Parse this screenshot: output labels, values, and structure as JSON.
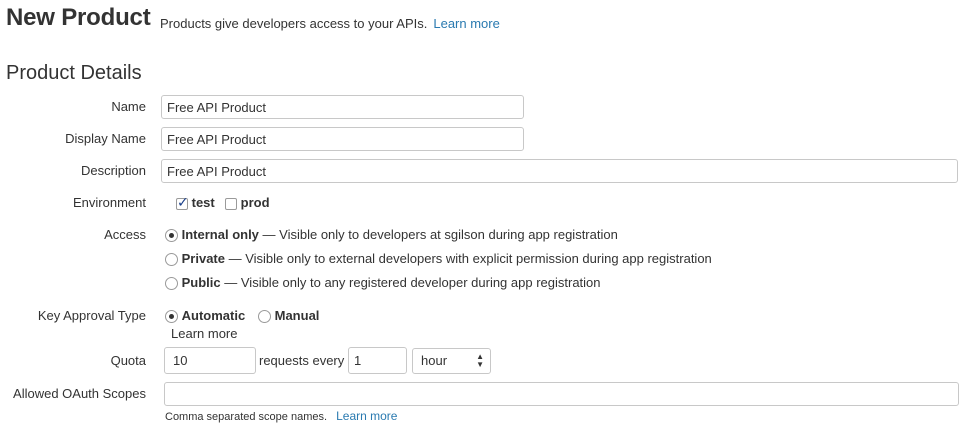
{
  "header": {
    "title": "New Product",
    "subtitle": "Products give developers access to your APIs.",
    "learn_more": "Learn more"
  },
  "section_title": "Product Details",
  "fields": {
    "name": {
      "label": "Name",
      "value": "Free API Product"
    },
    "display_name": {
      "label": "Display Name",
      "value": "Free API Product"
    },
    "description": {
      "label": "Description",
      "value": "Free API Product"
    },
    "environment": {
      "label": "Environment",
      "options": [
        {
          "label": "test",
          "checked": true
        },
        {
          "label": "prod",
          "checked": false
        }
      ]
    },
    "access": {
      "label": "Access",
      "options": [
        {
          "title": "Internal only",
          "desc": " — Visible only to developers at sgilson during app registration",
          "selected": true
        },
        {
          "title": "Private",
          "desc": " — Visible only to external developers with explicit permission during app registration",
          "selected": false
        },
        {
          "title": "Public",
          "desc": " — Visible only to any registered developer during app registration",
          "selected": false
        }
      ]
    },
    "key_approval": {
      "label": "Key Approval Type",
      "options": [
        {
          "label": "Automatic",
          "selected": true
        },
        {
          "label": "Manual",
          "selected": false
        }
      ],
      "learn_more": "Learn more"
    },
    "quota": {
      "label": "Quota",
      "value": "10",
      "requests_every": "requests every",
      "interval": "1",
      "unit": "hour"
    },
    "oauth_scopes": {
      "label": "Allowed OAuth Scopes",
      "value": "",
      "help": "Comma separated scope names.",
      "learn_more": "Learn more"
    }
  }
}
